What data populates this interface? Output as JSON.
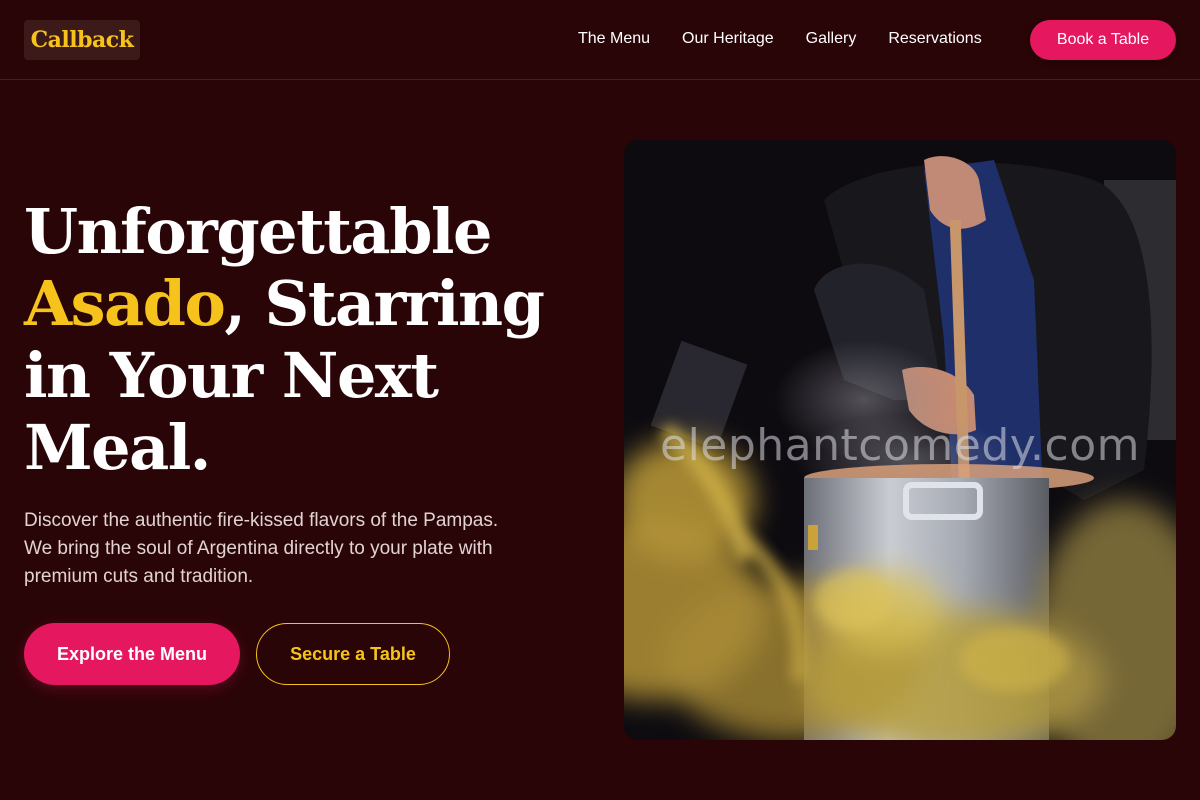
{
  "brand": {
    "logo_text": "Callback",
    "accent_color": "#f6c31c",
    "primary_color": "#e5175f",
    "background_color": "#2a0507"
  },
  "nav": {
    "items": [
      {
        "label": "The Menu"
      },
      {
        "label": "Our Heritage"
      },
      {
        "label": "Gallery"
      },
      {
        "label": "Reservations"
      }
    ],
    "cta_label": "Book a Table"
  },
  "hero": {
    "title_line1": "Unforgettable",
    "title_accent": "Asado",
    "title_after_accent": ", Starring",
    "title_line3": "in Your Next",
    "title_line4": "Meal.",
    "description": "Discover the authentic fire-kissed flavors of the Pampas. We bring the soul of Argentina directly to your plate with premium cuts and tradition.",
    "primary_cta": "Explore the Menu",
    "secondary_cta": "Secure a Table",
    "image_subject": "chef stirring a steaming stock pot",
    "watermark": "elephantcomedy.com"
  }
}
